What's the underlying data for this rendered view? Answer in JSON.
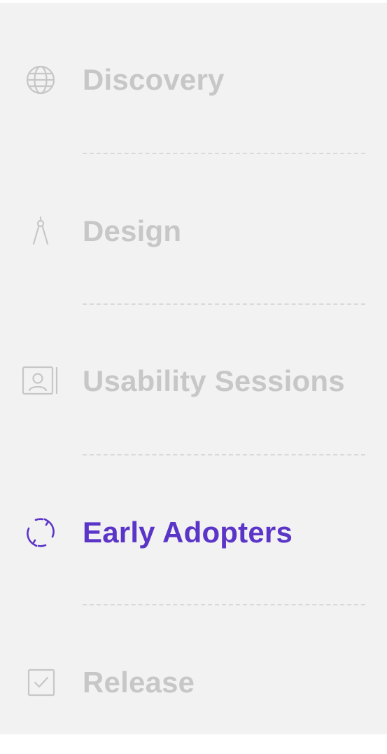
{
  "steps": [
    {
      "label": "Discovery",
      "icon": "globe-icon",
      "active": false
    },
    {
      "label": "Design",
      "icon": "compass-icon",
      "active": false
    },
    {
      "label": "Usability Sessions",
      "icon": "user-portrait-icon",
      "active": false
    },
    {
      "label": "Early Adopters",
      "icon": "refresh-cycle-icon",
      "active": true
    },
    {
      "label": "Release",
      "icon": "checkbox-checked-icon",
      "active": false
    }
  ],
  "colors": {
    "inactive": "#c7c7c7",
    "active": "#5b35c7",
    "background": "#f2f2f2",
    "divider": "#d9d9d9"
  }
}
